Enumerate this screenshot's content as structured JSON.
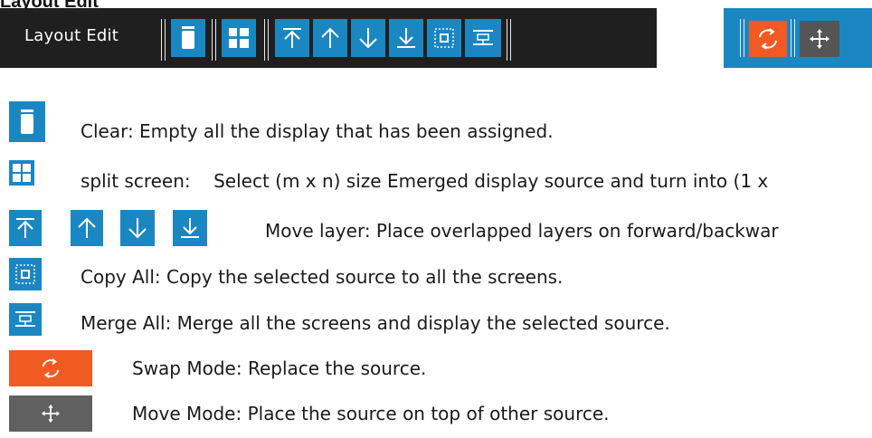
{
  "page": {
    "heading": "Layout Edit"
  },
  "toolbar": {
    "label": "Layout Edit",
    "buttons": [
      {
        "name": "clear",
        "icon": "trash-icon"
      },
      {
        "name": "split-screen",
        "icon": "grid-icon"
      },
      {
        "name": "move-top",
        "icon": "arrow-top-icon"
      },
      {
        "name": "move-up",
        "icon": "arrow-up-icon"
      },
      {
        "name": "move-down",
        "icon": "arrow-down-icon"
      },
      {
        "name": "move-bottom",
        "icon": "arrow-bottom-icon"
      },
      {
        "name": "copy-all",
        "icon": "copy-all-icon"
      },
      {
        "name": "merge-all",
        "icon": "merge-all-icon"
      }
    ]
  },
  "modes": {
    "swap_icon": "swap-icon",
    "move_icon": "move-icon"
  },
  "legend": {
    "clear": "Clear: Empty all the display that has been assigned.",
    "split": "split screen:    Select (m x n) size Emerged display source and turn into (1 x",
    "move_layer": "Move layer: Place overlapped layers on forward/backwar",
    "copy_all": "Copy All: Copy the selected source to all the screens.",
    "merge_all": "Merge All: Merge all the screens and display the selected source.",
    "swap_mode": "Swap Mode: Replace the source.",
    "move_mode": "Move Mode: Place the source on top of other source."
  },
  "colors": {
    "accent_blue": "#1b87c2",
    "toolbar_bg": "#1f1f1f",
    "swap_orange": "#f15a22",
    "move_grey": "#606060"
  }
}
